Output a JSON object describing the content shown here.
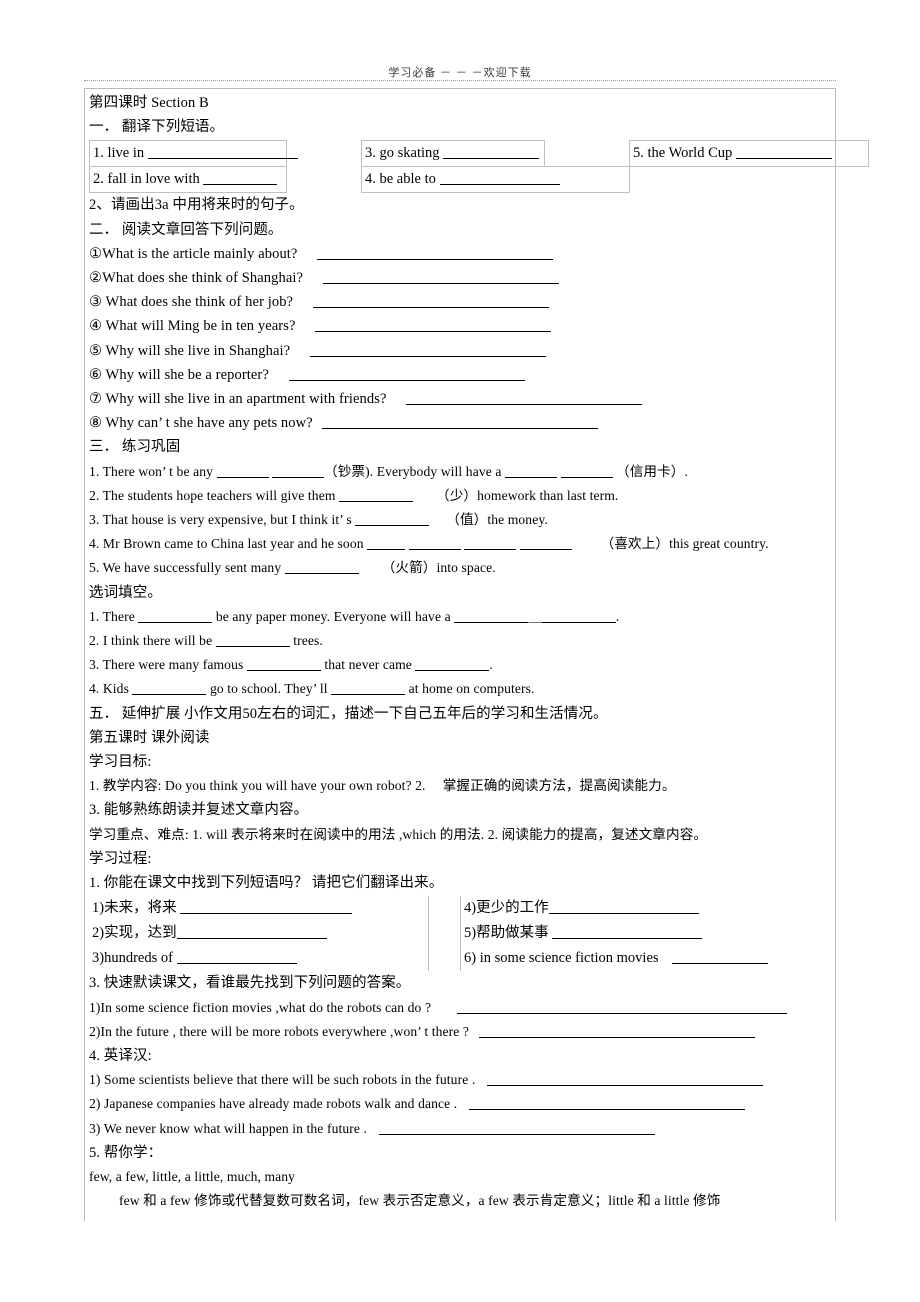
{
  "header": {
    "watermark": "学习必备 － － －欢迎下载"
  },
  "doc": {
    "section4_title": "第四课时 Section B",
    "part1_title": "一． 翻译下列短语。",
    "phrases_top": [
      {
        "label": "1. live in",
        "blank": "b-q"
      },
      {
        "label": "3. go skating",
        "blank": "b-l"
      },
      {
        "label": "5. the World Cup",
        "blank": "b-l"
      },
      {
        "label": "2. fall in love with",
        "blank": "b-m"
      },
      {
        "label": "4. be able to",
        "blank": "b-xl"
      }
    ],
    "line_draw_3a": "2、请画出3a 中用将来时的句子。",
    "part2_title": "二． 阅读文章回答下列问题。",
    "reading_questions": [
      {
        "text": "①What is the article mainly about?",
        "blank": "b-q4"
      },
      {
        "text": "②What does she think of Shanghai?",
        "blank": "b-q4"
      },
      {
        "text": "③ What does she think of her job?",
        "blank": "b-q4"
      },
      {
        "text": "④ What will Ming be in ten years?",
        "blank": "b-q4"
      },
      {
        "text": "⑤ Why will she live in Shanghai?",
        "blank": "b-q4"
      },
      {
        "text": "⑥ Why will she be a reporter?",
        "blank": "b-q4"
      },
      {
        "text": "⑦ Why will she live in an apartment with friends?",
        "blank": "b-q4"
      },
      {
        "text": "⑧ Why can’ t she have any pets now?",
        "blank": "b-q5"
      }
    ],
    "part3_title": "三． 练习巩固",
    "practice": {
      "q1_a": "1. There won’ t be any",
      "q1_b": "（钞票). Everybody will have a",
      "q1_c": "（信用卡）.",
      "q2_a": "2. The students hope teachers will give them",
      "q2_b": "（少）homework than last term.",
      "q3_a": "3. That house is very expensive, but I think it’ s",
      "q3_b": "（值）the money.",
      "q4_a": "4. Mr Brown came to China last year and he soon",
      "q4_b": "（喜欢上）this great country.",
      "q5_a": "5. We have successfully sent many",
      "q5_b": "（火箭）into space."
    },
    "cloze_title": "选词填空。",
    "cloze": {
      "c1_a": "1. There",
      "c1_b": "be any paper money. Everyone will have a",
      "c1_c": "＿",
      "c1_d": ".",
      "c2_a": "2. I think there will be",
      "c2_b": "trees.",
      "c3_a": "3. There were many famous",
      "c3_b": "that never came",
      "c3_c": ".",
      "c4_a": "4. Kids",
      "c4_b": "go to school. They’ ll",
      "c4_c": "at home on computers."
    },
    "part5_title": "五． 延伸扩展  小作文用50左右的词汇，描述一下自己五年后的学习和生活情况。",
    "section5_title": "第五课时  课外阅读",
    "goal_title": "学习目标:",
    "goal_1": "1. 教学内容: Do you think you will have your own robot? 2.　 掌握正确的阅读方法，提高阅读能力。",
    "goal_3": "3. 能够熟练朗读并复述文章内容。",
    "key_points": "学习重点、难点: 1. will 表示将来时在阅读中的用法 ,which 的用法. 2. 阅读能力的提高，复述文章内容。",
    "process_title": "学习过程:",
    "process_1": "1. 你能在课文中找到下列短语吗？ 请把它们翻译出来。",
    "phrases_2": [
      {
        "left": "1)未来，将来",
        "left_blank": "b-q2",
        "right": "4)更少的工作",
        "right_blank": "b-q"
      },
      {
        "left": "2)实现，达到",
        "left_blank": "b-q",
        "right": "5)帮助做某事",
        "right_blank": "b-q"
      },
      {
        "left": "3)hundreds of",
        "left_blank": "b-xl",
        "right": "6) in some science fiction movies",
        "right_blank": "b-l"
      }
    ],
    "process_3": "3. 快速默读课文，看谁最先找到下列问题的答案。",
    "process_3_items": [
      {
        "text": "1)In some science fiction movies ,what do the robots can do ?",
        "blank": "b-q6"
      },
      {
        "text": "2)In the future , there will be more robots everywhere ,won’ t there ?",
        "blank": "b-q5"
      }
    ],
    "process_4_title": "4. 英译汉:",
    "process_4_items": [
      {
        "text": "1) Some scientists believe that there will be such robots in the future .",
        "blank": "b-q5"
      },
      {
        "text": "2) Japanese companies have already made robots walk and dance .",
        "blank": "b-q5"
      },
      {
        "text": "3) We never know what will happen in the future .",
        "blank": "b-q5"
      }
    ],
    "process_5_title": "5. 帮你学：",
    "word_list": "few, a few, little, a little, much, many",
    "grammar_note": "few 和 a few 修饰或代替复数可数名词，few 表示否定意义，a few 表示肯定意义；little 和 a little 修饰"
  }
}
